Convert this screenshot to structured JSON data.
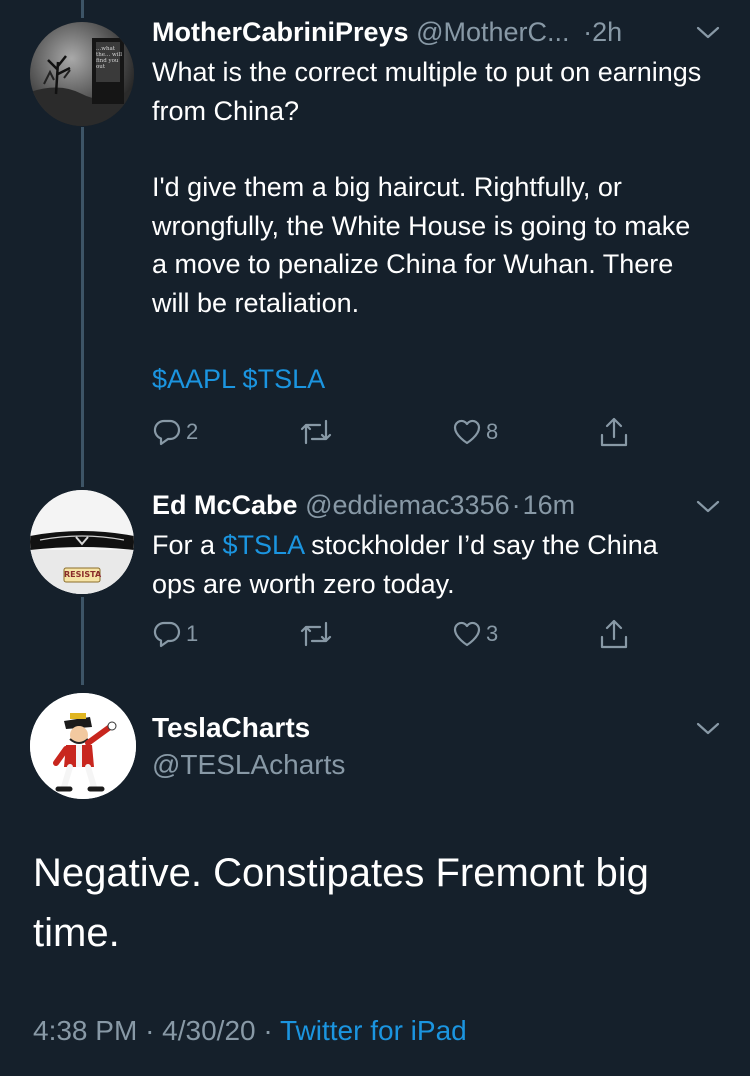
{
  "tweets": [
    {
      "name": "MotherCabriniPreys",
      "handle": "@MotherC...",
      "separator": "·",
      "time": "2h",
      "paragraph1": "What is the correct multiple to put on earnings from China?",
      "paragraph2": "I'd give them a big haircut. Rightfully, or wrongfully, the White House is going to make a move to penalize China for Wuhan. There will be retaliation.",
      "cashtags": "$AAPL $TSLA",
      "reply_count": "2",
      "like_count": "8",
      "avatar_text": "...what the... will find you out"
    },
    {
      "name": "Ed McCabe",
      "handle": "@eddiemac3356",
      "separator": "·",
      "time": "16m",
      "text_pre": "For a ",
      "cashtag": "$TSLA",
      "text_post": " stockholder I’d say the China ops are worth zero today.",
      "reply_count": "1",
      "like_count": "3",
      "plate_text": "RESISTA"
    }
  ],
  "main_tweet": {
    "name": "TeslaCharts",
    "handle": "@TESLAcharts",
    "text": "Negative. Constipates Fremont big time.",
    "time": "4:38 PM",
    "sep": "·",
    "date": "4/30/20",
    "source": "Twitter for iPad"
  },
  "icons": {
    "reply": "reply-icon",
    "retweet": "retweet-icon",
    "like": "like-icon",
    "share": "share-icon",
    "chevron": "chevron-down-icon"
  },
  "colors": {
    "background": "#15202b",
    "secondary_text": "#8899a6",
    "link": "#1b95e0",
    "thread_line": "#3d5466"
  }
}
